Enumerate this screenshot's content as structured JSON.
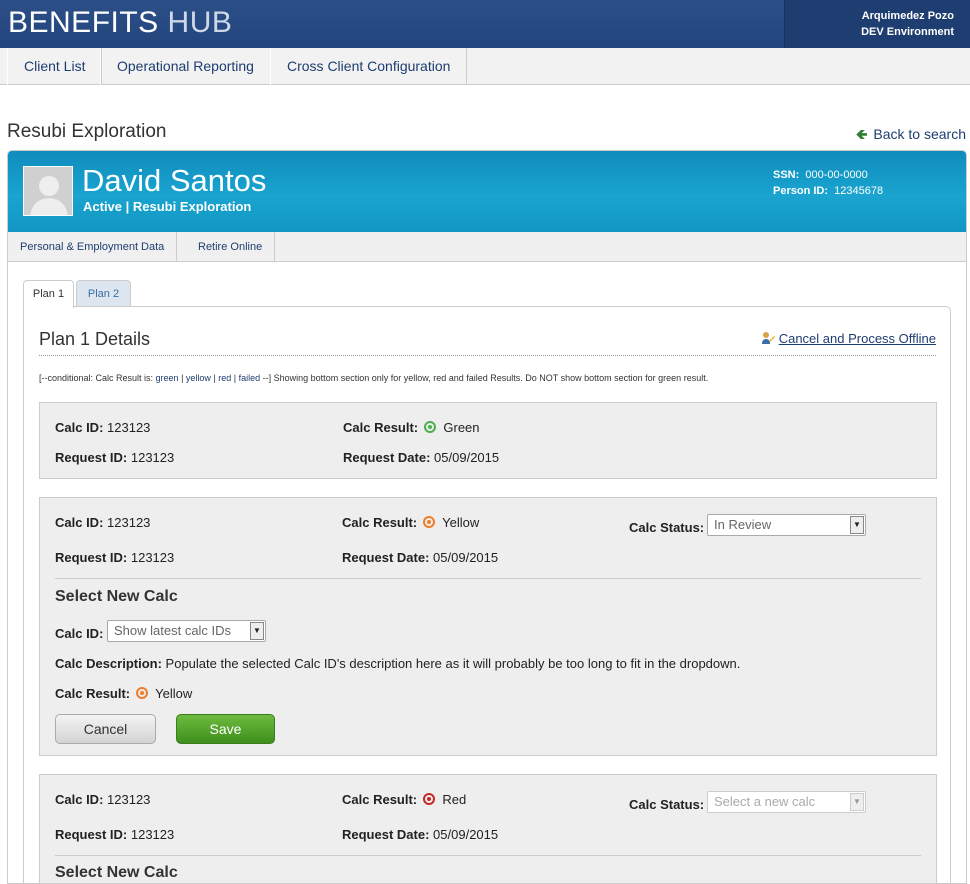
{
  "app": {
    "brand_main": "BENEFITS",
    "brand_sub": "HUB",
    "user": "Arquimedez Pozo",
    "env": "DEV Environment"
  },
  "nav": [
    "Client List",
    "Operational Reporting",
    "Cross Client Configuration"
  ],
  "page": {
    "title": "Resubi Exploration",
    "back": "Back to search"
  },
  "person": {
    "name": "David Santos",
    "status": "Active | Resubi Exploration",
    "ssn_label": "SSN:",
    "ssn": "000-00-0000",
    "pid_label": "Person ID:",
    "pid": "12345678"
  },
  "subnav": [
    "Personal & Employment Data",
    "Retire Online"
  ],
  "tabs": [
    "Plan 1",
    "Plan 2"
  ],
  "panel": {
    "title": "Plan 1 Details",
    "cancel_offline": "Cancel and Process Offline",
    "note_pre": "[--conditional: Calc Result is: ",
    "note_green": "green",
    "note_yellow": "yellow",
    "note_red": "red",
    "note_failed": "failed",
    "note_post": " --] Showing bottom section only for yellow, red and failed Results. Do NOT show bottom section for green result.",
    "sep": " | "
  },
  "labels": {
    "calc_id": "Calc ID:",
    "request_id": "Request ID:",
    "calc_result": "Calc Result:",
    "request_date": "Request Date:",
    "calc_status": "Calc Status:",
    "select_new": "Select New Calc",
    "calc_desc": "Calc Description:",
    "cancel": "Cancel",
    "save": "Save"
  },
  "calcs": [
    {
      "calc_id": "123123",
      "request_id": "123123",
      "result": "Green",
      "result_color": "#4caf50",
      "request_date": "05/09/2015"
    },
    {
      "calc_id": "123123",
      "request_id": "123123",
      "result": "Yellow",
      "result_color": "#f07d2a",
      "request_date": "05/09/2015",
      "status": "In Review",
      "new_calc": {
        "placeholder": "Show latest calc IDs",
        "description": "Populate the selected Calc ID's description here as it will probably be too long to fit in the dropdown.",
        "result": "Yellow"
      }
    },
    {
      "calc_id": "123123",
      "request_id": "123123",
      "result": "Red",
      "result_color": "#c62828",
      "request_date": "05/09/2015",
      "status_placeholder": "Select a new calc"
    }
  ]
}
